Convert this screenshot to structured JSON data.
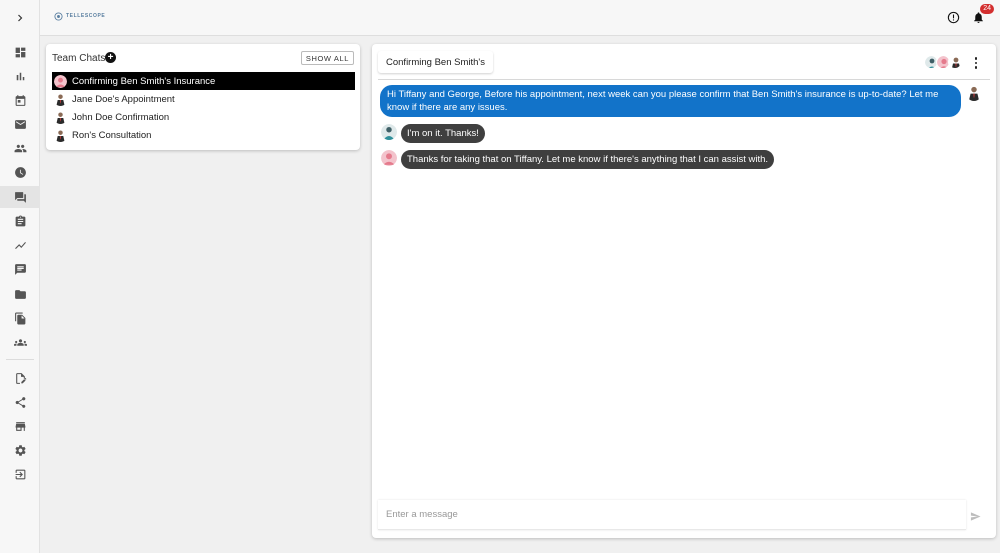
{
  "app": {
    "logo_text": "TELLESCOPE",
    "notification_count": "24",
    "accent_color": "#1273c9",
    "badge_color": "#d32f2f"
  },
  "sidebar": {
    "items": [
      {
        "name": "dashboard",
        "icon": "dashboard-icon"
      },
      {
        "name": "analytics",
        "icon": "bar-chart-icon"
      },
      {
        "name": "calendar",
        "icon": "calendar-icon"
      },
      {
        "name": "inbox",
        "icon": "mail-icon"
      },
      {
        "name": "contacts",
        "icon": "people-icon"
      },
      {
        "name": "history",
        "icon": "clock-icon"
      },
      {
        "name": "team-chat",
        "icon": "chat-bubbles-icon",
        "active": true
      },
      {
        "name": "forms",
        "icon": "clipboard-icon"
      },
      {
        "name": "trends",
        "icon": "trend-line-icon"
      },
      {
        "name": "messages",
        "icon": "message-icon"
      },
      {
        "name": "files",
        "icon": "folder-icon"
      },
      {
        "name": "documents",
        "icon": "documents-icon"
      },
      {
        "name": "groups",
        "icon": "groups-icon"
      },
      {
        "name": "settings-group-divider",
        "icon": "divider"
      },
      {
        "name": "forms-builder",
        "icon": "edit-document-icon"
      },
      {
        "name": "integrations",
        "icon": "share-icon"
      },
      {
        "name": "store",
        "icon": "store-icon"
      },
      {
        "name": "settings",
        "icon": "gear-icon"
      },
      {
        "name": "logout",
        "icon": "logout-icon"
      }
    ]
  },
  "team_chats": {
    "title": "Team Chats",
    "show_all_label": "SHOW ALL",
    "items": [
      {
        "label": "Confirming Ben Smith's Insurance",
        "selected": true,
        "avatar": "pink"
      },
      {
        "label": "Jane Doe's Appointment",
        "selected": false,
        "avatar": "suit"
      },
      {
        "label": "John Doe Confirmation",
        "selected": false,
        "avatar": "suit"
      },
      {
        "label": "Ron's Consultation",
        "selected": false,
        "avatar": "suit"
      }
    ]
  },
  "conversation": {
    "title": "Confirming Ben Smith's Insurance",
    "tab_label": "Confirming Ben Smith's",
    "messages": [
      {
        "direction": "out",
        "text": "Hi Tiffany and George, Before his appointment, next week can you please confirm that Ben Smith's insurance is up-to-date? Let me know if there are any issues.",
        "avatar": "suit"
      },
      {
        "direction": "in",
        "text": "I'm on it. Thanks!",
        "avatar": "teal"
      },
      {
        "direction": "in",
        "text": "Thanks for taking that on Tiffany. Let me know if there's anything that I can assist with.",
        "avatar": "pink"
      }
    ],
    "composer_placeholder": "Enter a message"
  }
}
